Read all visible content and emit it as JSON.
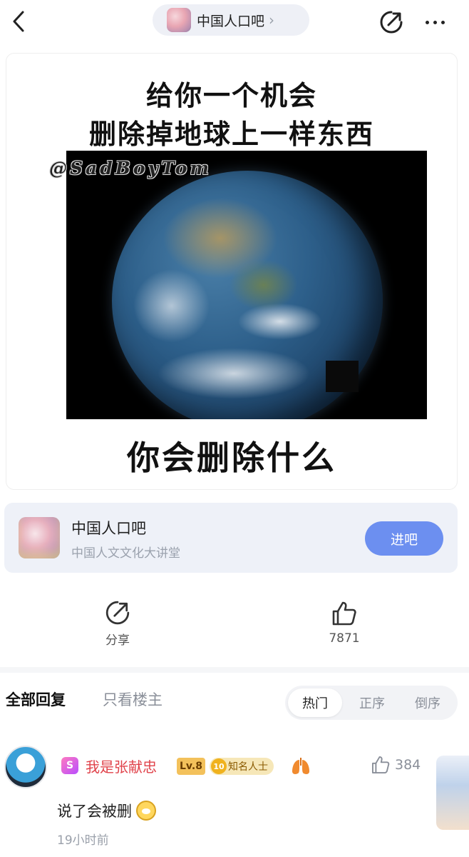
{
  "header": {
    "forum_name": "中国人口吧",
    "chevron": "›"
  },
  "post": {
    "meme_line1": "给你一个机会",
    "meme_line2": "删除掉地球上一样东西",
    "watermark": "@SadBoyTom",
    "meme_line3": "你会删除什么"
  },
  "forum_card": {
    "name": "中国人口吧",
    "description": "中国人文文化大讲堂",
    "enter_label": "进吧",
    "accent_color": "#6c8ff0"
  },
  "actions": {
    "share_label": "分享",
    "like_count": "7871"
  },
  "replies": {
    "tab_all": "全部回复",
    "tab_op_only": "只看楼主",
    "sort_options": [
      "热门",
      "正序",
      "倒序"
    ],
    "selected_sort": "热门"
  },
  "comment": {
    "badge": "S",
    "username": "我是张献忠",
    "level": "Lv.8",
    "famous_number": "10",
    "famous_label": "知名人士",
    "like_count": "384",
    "text": "说了会被删",
    "time": "19小时前",
    "username_color": "#e0424a"
  }
}
